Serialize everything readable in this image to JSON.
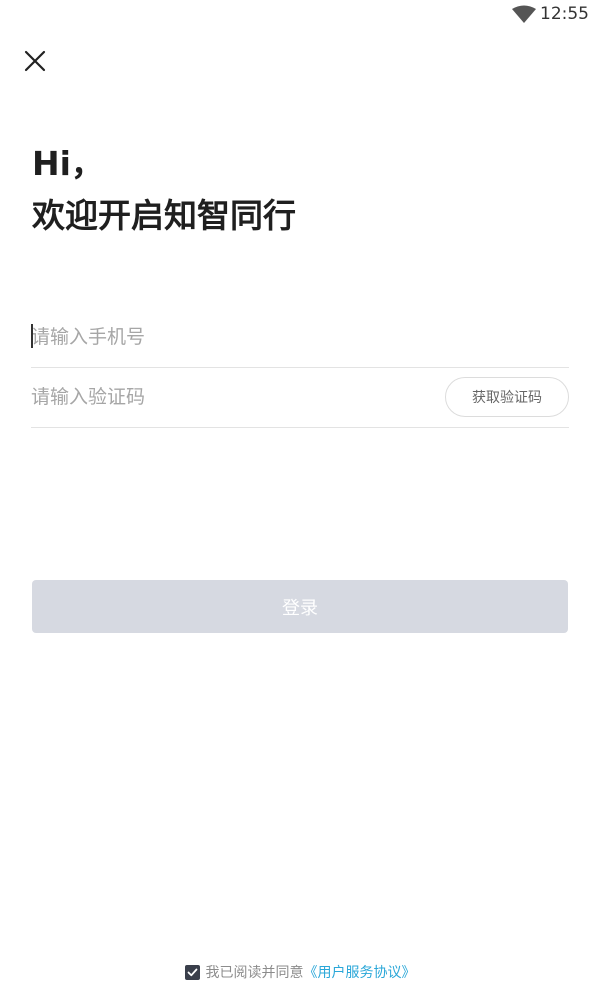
{
  "status_bar": {
    "time": "12:55",
    "wifi_icon": "wifi-icon"
  },
  "header": {
    "close_icon": "close-icon"
  },
  "greeting": {
    "line1": "Hi，",
    "line2": "欢迎开启知智同行"
  },
  "form": {
    "phone_placeholder": "请输入手机号",
    "phone_value": "",
    "code_placeholder": "请输入验证码",
    "code_value": "",
    "get_code_label": "获取验证码"
  },
  "login_button": {
    "label": "登录",
    "color": "#d6d9e1",
    "enabled": false
  },
  "agreement": {
    "checked": true,
    "text": "我已阅读并同意",
    "link_text": "《用户服务协议》",
    "link_color": "#2aa7d8"
  }
}
